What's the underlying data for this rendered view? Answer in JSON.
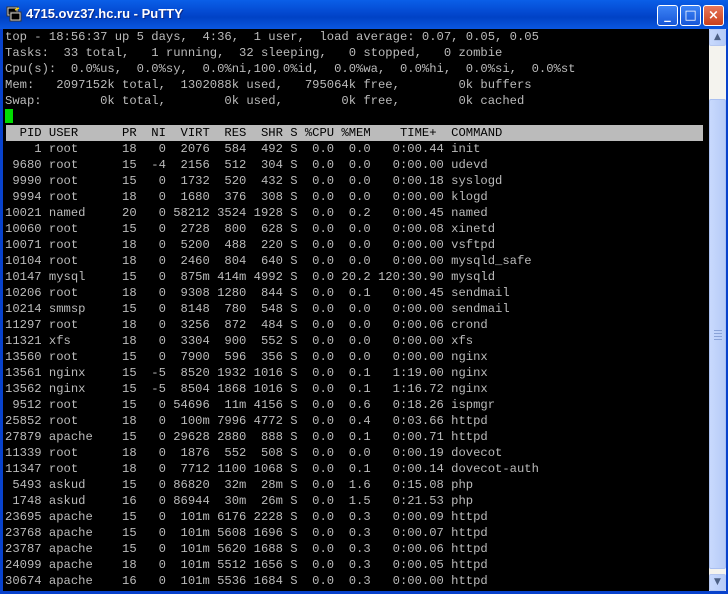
{
  "window": {
    "title": "4715.ovz37.hc.ru - PuTTY",
    "minimize_glyph": "_",
    "maximize_glyph": "□",
    "close_glyph": "×"
  },
  "colors": {
    "terminal_bg": "#000000",
    "terminal_fg": "#bbbbbb",
    "cursor": "#00dd00",
    "titlebar": "#0348cf"
  },
  "summary": [
    "top - 18:56:37 up 5 days,  4:36,  1 user,  load average: 0.07, 0.05, 0.05",
    "Tasks:  33 total,   1 running,  32 sleeping,   0 stopped,   0 zombie",
    "Cpu(s):  0.0%us,  0.0%sy,  0.0%ni,100.0%id,  0.0%wa,  0.0%hi,  0.0%si,  0.0%st",
    "Mem:   2097152k total,  1302088k used,   795064k free,        0k buffers",
    "Swap:        0k total,        0k used,        0k free,        0k cached"
  ],
  "process_table": {
    "header": "  PID USER      PR  NI  VIRT  RES  SHR S %CPU %MEM    TIME+  COMMAND",
    "rows": [
      "    1 root      18   0  2076  584  492 S  0.0  0.0   0:00.44 init",
      " 9680 root      15  -4  2156  512  304 S  0.0  0.0   0:00.00 udevd",
      " 9990 root      15   0  1732  520  432 S  0.0  0.0   0:00.18 syslogd",
      " 9994 root      18   0  1680  376  308 S  0.0  0.0   0:00.00 klogd",
      "10021 named     20   0 58212 3524 1928 S  0.0  0.2   0:00.45 named",
      "10060 root      15   0  2728  800  628 S  0.0  0.0   0:00.08 xinetd",
      "10071 root      18   0  5200  488  220 S  0.0  0.0   0:00.00 vsftpd",
      "10104 root      18   0  2460  804  640 S  0.0  0.0   0:00.00 mysqld_safe",
      "10147 mysql     15   0  875m 414m 4992 S  0.0 20.2 120:30.90 mysqld",
      "10206 root      18   0  9308 1280  844 S  0.0  0.1   0:00.45 sendmail",
      "10214 smmsp     15   0  8148  780  548 S  0.0  0.0   0:00.00 sendmail",
      "11297 root      18   0  3256  872  484 S  0.0  0.0   0:00.06 crond",
      "11321 xfs       18   0  3304  900  552 S  0.0  0.0   0:00.00 xfs",
      "13560 root      15   0  7900  596  356 S  0.0  0.0   0:00.00 nginx",
      "13561 nginx     15  -5  8520 1932 1016 S  0.0  0.1   1:19.00 nginx",
      "13562 nginx     15  -5  8504 1868 1016 S  0.0  0.1   1:16.72 nginx",
      " 9512 root      15   0 54696  11m 4156 S  0.0  0.6   0:18.26 ispmgr",
      "25852 root      18   0  100m 7996 4772 S  0.0  0.4   0:03.66 httpd",
      "27879 apache    15   0 29628 2880  888 S  0.0  0.1   0:00.71 httpd",
      "11339 root      18   0  1876  552  508 S  0.0  0.0   0:00.19 dovecot",
      "11347 root      18   0  7712 1100 1068 S  0.0  0.1   0:00.14 dovecot-auth",
      " 5493 askud     15   0 86820  32m  28m S  0.0  1.6   0:15.08 php",
      " 1748 askud     16   0 86944  30m  26m S  0.0  1.5   0:21.53 php",
      "23695 apache    15   0  101m 6176 2228 S  0.0  0.3   0:00.09 httpd",
      "23768 apache    15   0  101m 5608 1696 S  0.0  0.3   0:00.07 httpd",
      "23787 apache    15   0  101m 5620 1688 S  0.0  0.3   0:00.06 httpd",
      "24099 apache    18   0  101m 5512 1656 S  0.0  0.3   0:00.05 httpd",
      "30674 apache    16   0  101m 5536 1684 S  0.0  0.3   0:00.00 httpd"
    ]
  },
  "scrollbar": {
    "up_glyph": "▲",
    "down_glyph": "▼"
  }
}
